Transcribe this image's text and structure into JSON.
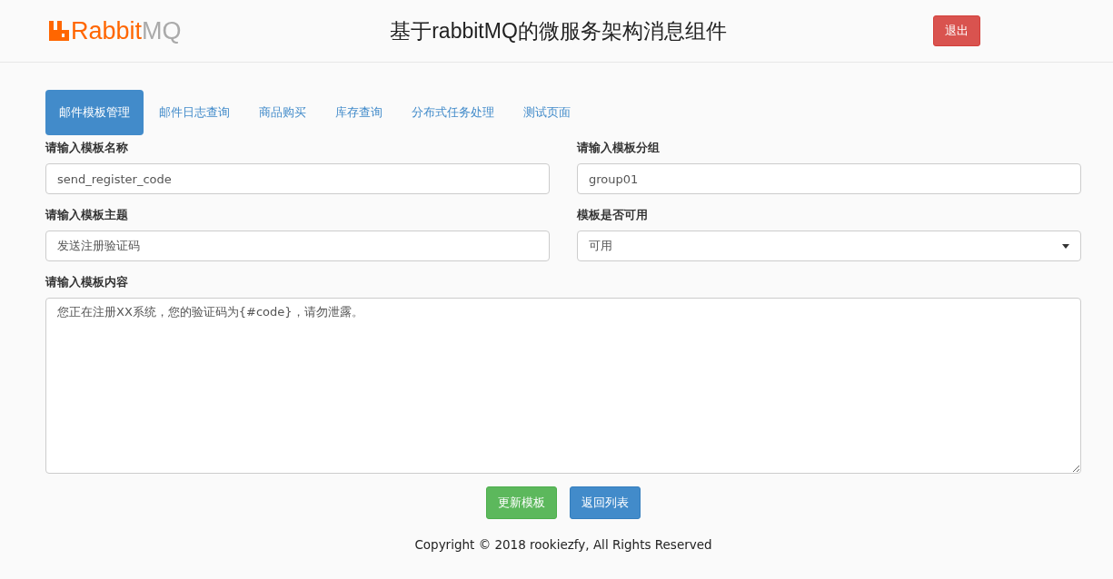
{
  "header": {
    "logo": {
      "brand": "Rabbit",
      "suffix": "MQ"
    },
    "title": "基于rabbitMQ的微服务架构消息组件",
    "logout": "退出"
  },
  "tabs": [
    {
      "label": "邮件模板管理",
      "selected": true
    },
    {
      "label": "邮件日志查询",
      "selected": false
    },
    {
      "label": "商品购买",
      "selected": false
    },
    {
      "label": "库存查询",
      "selected": false
    },
    {
      "label": "分布式任务处理",
      "selected": false
    },
    {
      "label": "测试页面",
      "selected": false
    }
  ],
  "form": {
    "fields": [
      {
        "kind": "text",
        "label": "请输入模板名称",
        "value": "send_register_code"
      },
      {
        "kind": "text",
        "label": "请输入模板分组",
        "value": "group01"
      },
      {
        "kind": "text",
        "label": "请输入模板主题",
        "value": "发送注册验证码"
      },
      {
        "kind": "select",
        "label": "模板是否可用",
        "value": "可用"
      }
    ],
    "content": {
      "label": "请输入模板内容",
      "value": "您正在注册XX系统，您的验证码为{#code}，请勿泄露。"
    }
  },
  "buttons": [
    {
      "kind": "success",
      "label": "更新模板"
    },
    {
      "kind": "primary",
      "label": "返回列表"
    }
  ],
  "footer": "Copyright © 2018 rookiezfy, All Rights Reserved"
}
